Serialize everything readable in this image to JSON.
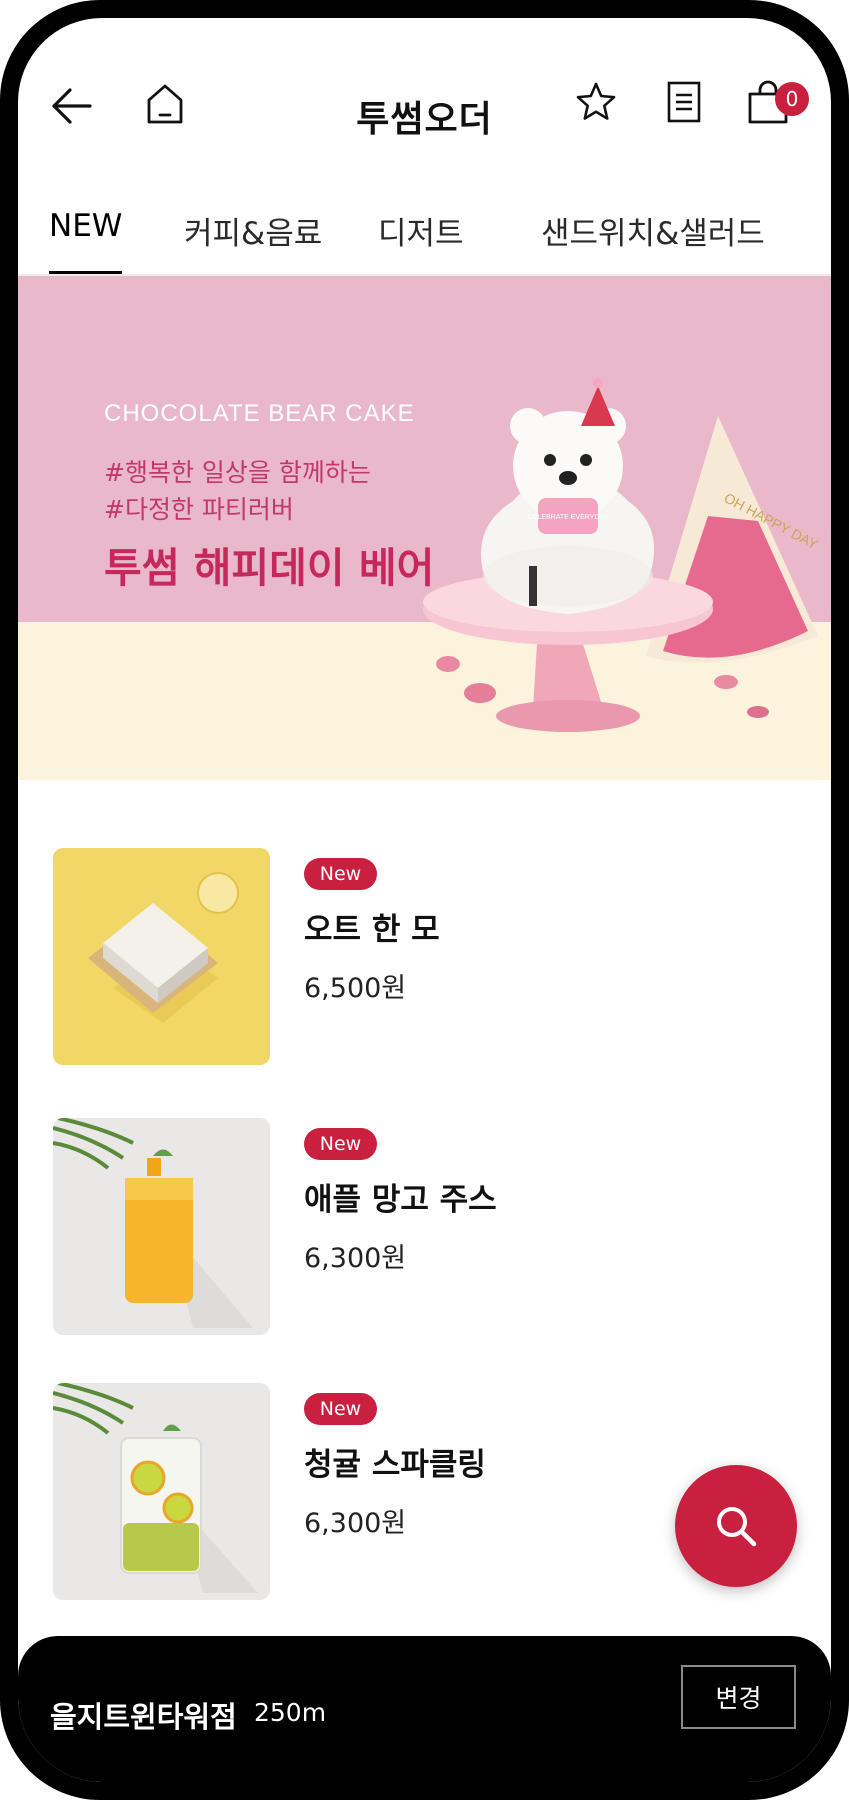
{
  "header": {
    "title": "투썸오더",
    "cart_count": "0",
    "icons": [
      "back-arrow-icon",
      "home-icon",
      "star-icon",
      "receipt-icon",
      "shopping-bag-icon"
    ]
  },
  "tabs": [
    {
      "label": "NEW",
      "active": true
    },
    {
      "label": "커피&음료",
      "active": false
    },
    {
      "label": "디저트",
      "active": false
    },
    {
      "label": "샌드위치&샐러드",
      "active": false
    }
  ],
  "banner": {
    "subtitle": "CHOCOLATE BEAR CAKE",
    "tag1": "#행복한 일상을 함께하는",
    "tag2": "#다정한 파티러버",
    "title": "투썸 해피데이 베어",
    "cake_plate_text": "CELEBRATE EVERYDAY",
    "hat_text": "OH HAPPY DAY",
    "colors": {
      "pink": "#eab8cb",
      "cream": "#fcf3dc",
      "accent": "#c5295b"
    }
  },
  "products": [
    {
      "badge": "New",
      "name": "오트 한 모",
      "price": "6,500원"
    },
    {
      "badge": "New",
      "name": "애플 망고 주스",
      "price": "6,300원"
    },
    {
      "badge": "New",
      "name": "청귤 스파클링",
      "price": "6,300원"
    }
  ],
  "fab": {
    "icon": "search-icon"
  },
  "store": {
    "name": "을지트윈타워점",
    "distance": "250m",
    "change_label": "변경"
  },
  "theme": {
    "brand_red": "#c8203e"
  }
}
